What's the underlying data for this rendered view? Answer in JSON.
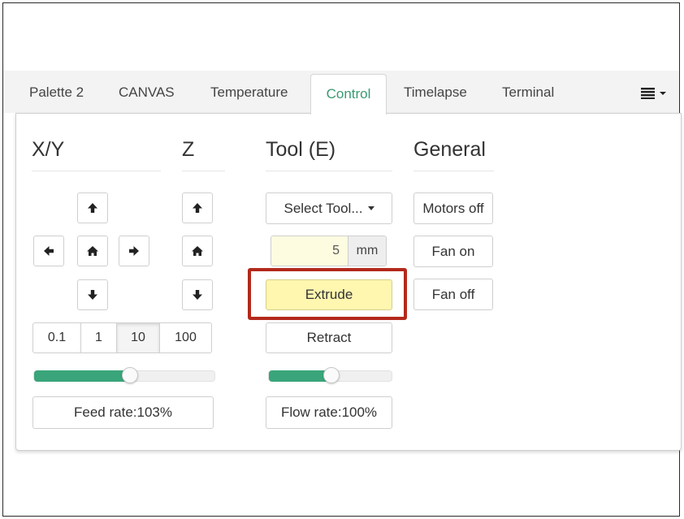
{
  "tabs": [
    {
      "label": "Palette 2"
    },
    {
      "label": "CANVAS"
    },
    {
      "label": "Temperature"
    },
    {
      "label": "Control"
    },
    {
      "label": "Timelapse"
    },
    {
      "label": "Terminal"
    }
  ],
  "menu_icon": "hamburger-menu-icon",
  "columns": {
    "xy": {
      "title": "X/Y"
    },
    "z": {
      "title": "Z"
    },
    "tool": {
      "title": "Tool (E)"
    },
    "general": {
      "title": "General"
    }
  },
  "step_sizes": [
    "0.1",
    "1",
    "10",
    "100"
  ],
  "step_selected": "10",
  "feed_rate": {
    "label": "Feed rate:103%",
    "percent": 103
  },
  "flow_rate": {
    "label": "Flow rate:100%",
    "percent": 100
  },
  "tool": {
    "select_label": "Select Tool...",
    "amount_value": "5",
    "amount_unit": "mm",
    "extrude_label": "Extrude",
    "retract_label": "Retract"
  },
  "general": {
    "motors_off": "Motors off",
    "fan_on": "Fan on",
    "fan_off": "Fan off"
  },
  "colors": {
    "accent": "#3aa57a",
    "highlight_box": "#b3291b",
    "extrude_bg": "#fff6b0"
  }
}
